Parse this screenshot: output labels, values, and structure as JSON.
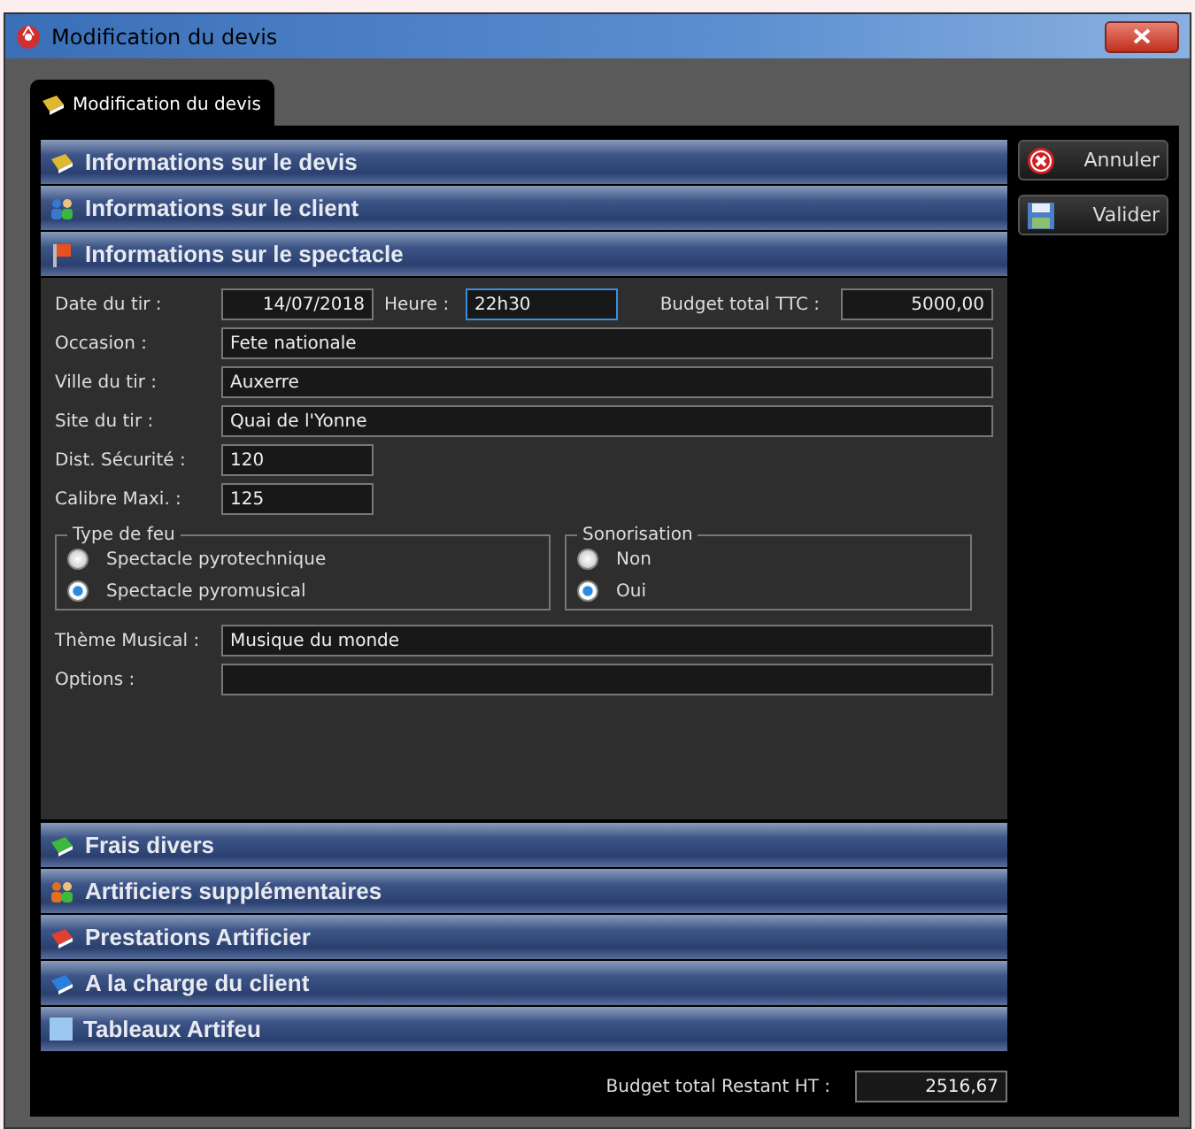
{
  "window": {
    "title": "Modification du devis"
  },
  "tab": {
    "label": "Modification du devis",
    "selected": true
  },
  "sections": [
    {
      "title": "Informations sur le devis",
      "kind": "book",
      "color": "#e0b830"
    },
    {
      "title": "Informations sur le client",
      "kind": "people",
      "color": "#3a78d0"
    },
    {
      "title": "Informations sur le spectacle",
      "kind": "flag",
      "color": "#e85020",
      "form": {
        "date": {
          "label": "Date du tir :",
          "value": "14/07/2018"
        },
        "heure": {
          "label": "Heure :",
          "value": "22h30",
          "focused": true
        },
        "budget": {
          "label": "Budget total TTC :",
          "value": "5000,00"
        },
        "wide_fields": [
          {
            "label": "Occasion :",
            "value": "Fete nationale"
          },
          {
            "label": "Ville du tir :",
            "value": "Auxerre"
          },
          {
            "label": "Site du tir :",
            "value": "Quai de l'Yonne"
          }
        ],
        "short_fields": [
          {
            "label": "Dist. Sécurité :",
            "value": "120"
          },
          {
            "label": "Calibre Maxi. :",
            "value": "125"
          }
        ],
        "groups": [
          {
            "title": "Type de feu",
            "options": [
              {
                "label": "Spectacle pyrotechnique",
                "selected": false
              },
              {
                "label": "Spectacle pyromusical",
                "selected": true
              }
            ]
          },
          {
            "title": "Sonorisation",
            "options": [
              {
                "label": "Non",
                "selected": false
              },
              {
                "label": "Oui",
                "selected": true
              }
            ]
          }
        ],
        "bottom_fields": [
          {
            "label": "Thème Musical :",
            "value": "Musique du monde"
          },
          {
            "label": "Options :"
          }
        ]
      }
    },
    {
      "title": "Frais divers",
      "kind": "book",
      "color": "#3cb83c"
    },
    {
      "title": "Artificiers supplémentaires",
      "kind": "people",
      "color": "#e07020"
    },
    {
      "title": "Prestations Artificier",
      "kind": "book",
      "color": "#e04030"
    },
    {
      "title": "A la charge du client",
      "kind": "book",
      "color": "#2a80e0"
    },
    {
      "title": "Tableaux Artifeu",
      "kind": "grid",
      "color": "#9cc8f0"
    }
  ],
  "buttons": [
    {
      "label": "Annuler",
      "kind": "cancel"
    },
    {
      "label": "Valider",
      "kind": "save"
    }
  ],
  "footer": {
    "label": "Budget total Restant HT :",
    "value": "2516,67"
  }
}
